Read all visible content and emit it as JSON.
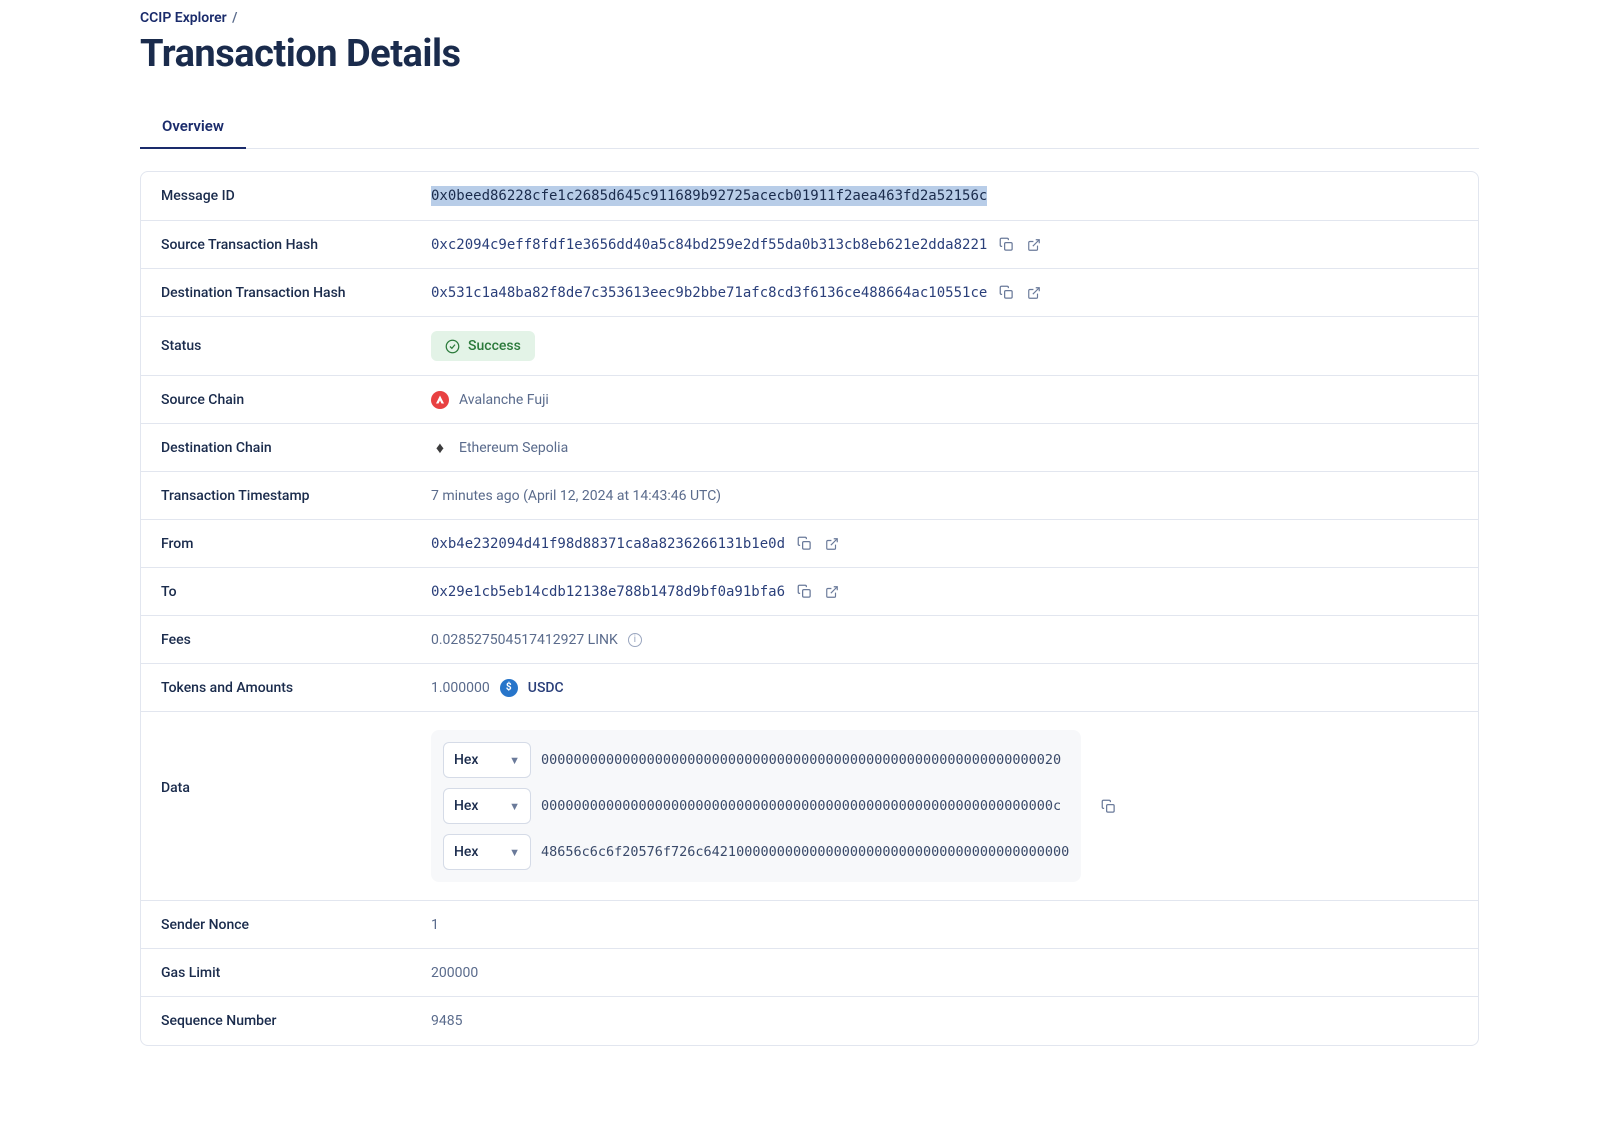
{
  "breadcrumb": {
    "root": "CCIP Explorer",
    "sep": "/"
  },
  "page_title": "Transaction Details",
  "tabs": {
    "overview": "Overview"
  },
  "rows": {
    "message_id": {
      "label": "Message ID",
      "value": "0x0beed86228cfe1c2685d645c911689b92725acecb01911f2aea463fd2a52156c"
    },
    "src_tx_hash": {
      "label": "Source Transaction Hash",
      "value": "0xc2094c9eff8fdf1e3656dd40a5c84bd259e2df55da0b313cb8eb621e2dda8221"
    },
    "dst_tx_hash": {
      "label": "Destination Transaction Hash",
      "value": "0x531c1a48ba82f8de7c353613eec9b2bbe71afc8cd3f6136ce488664ac10551ce"
    },
    "status": {
      "label": "Status",
      "value": "Success"
    },
    "src_chain": {
      "label": "Source Chain",
      "value": "Avalanche Fuji"
    },
    "dst_chain": {
      "label": "Destination Chain",
      "value": "Ethereum Sepolia"
    },
    "timestamp": {
      "label": "Transaction Timestamp",
      "value": "7 minutes ago (April 12, 2024 at 14:43:46 UTC)"
    },
    "from": {
      "label": "From",
      "value": "0xb4e232094d41f98d88371ca8a8236266131b1e0d"
    },
    "to": {
      "label": "To",
      "value": "0x29e1cb5eb14cdb12138e788b1478d9bf0a91bfa6"
    },
    "fees": {
      "label": "Fees",
      "value": "0.028527504517412927 LINK"
    },
    "tokens": {
      "label": "Tokens and Amounts",
      "amount": "1.000000",
      "symbol": "USDC"
    },
    "data": {
      "label": "Data",
      "select_label": "Hex",
      "lines": [
        "0000000000000000000000000000000000000000000000000000000000000020",
        "000000000000000000000000000000000000000000000000000000000000000c",
        "48656c6c6f20576f726c642100000000000000000000000000000000000000000"
      ]
    },
    "nonce": {
      "label": "Sender Nonce",
      "value": "1"
    },
    "gas_limit": {
      "label": "Gas Limit",
      "value": "200000"
    },
    "seq": {
      "label": "Sequence Number",
      "value": "9485"
    }
  }
}
